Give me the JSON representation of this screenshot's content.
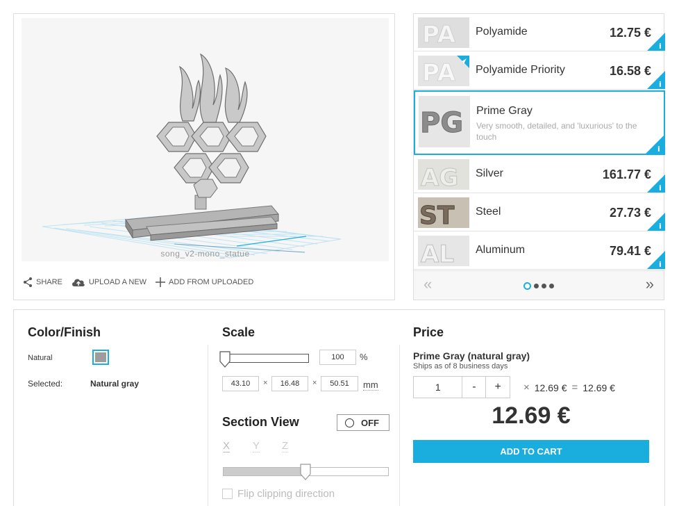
{
  "viewer": {
    "model_name": "song_v2-mono_statue",
    "actions": [
      {
        "label": "SHARE",
        "icon": "share-icon"
      },
      {
        "label": "UPLOAD A NEW",
        "icon": "cloud-upload-icon"
      },
      {
        "label": "ADD FROM UPLOADED",
        "icon": "plus-icon"
      }
    ]
  },
  "materials": {
    "items": [
      {
        "name": "Polyamide",
        "price": "12.75 €",
        "thumb_text": "PA"
      },
      {
        "name": "Polyamide Priority",
        "price": "16.58 €",
        "thumb_text": "PA"
      },
      {
        "name": "Prime Gray",
        "description": "Very smooth, detailed, and 'luxurious' to the touch",
        "thumb_text": "PG",
        "selected": true
      },
      {
        "name": "Silver",
        "price": "161.77 €",
        "thumb_text": "AG"
      },
      {
        "name": "Steel",
        "price": "27.73 €",
        "thumb_text": "ST"
      },
      {
        "name": "Aluminum",
        "price": "79.41 €",
        "thumb_text": "AL"
      }
    ],
    "pager": {
      "prev": "«",
      "next": "»",
      "pages": 4,
      "current": 1
    }
  },
  "color_finish": {
    "heading": "Color/Finish",
    "option_label": "Natural",
    "selected_label": "Selected:",
    "selected_value": "Natural gray",
    "swatch_color": "#9d9d9d"
  },
  "scale": {
    "heading": "Scale",
    "percent_value": "100",
    "percent_unit": "%",
    "dims": [
      "43.10",
      "16.48",
      "50.51"
    ],
    "times": "×",
    "unit": "mm"
  },
  "section_view": {
    "heading": "Section View",
    "toggle_label": "OFF",
    "axes": [
      "X",
      "Y",
      "Z"
    ],
    "clip_level": 0.5,
    "flip_label": "Flip clipping direction"
  },
  "price": {
    "heading": "Price",
    "material_line": "Prime Gray (natural gray)",
    "ships": "Ships as of 8 business days",
    "quantity": "1",
    "minus": "-",
    "plus": "+",
    "times": "×",
    "unit_price": "12.69 €",
    "equals": "=",
    "line_total": "12.69 €",
    "total": "12.69 €",
    "cta": "ADD TO CART"
  },
  "colors": {
    "accent": "#1aaede",
    "text": "#333333",
    "muted": "#aaaaaa"
  }
}
